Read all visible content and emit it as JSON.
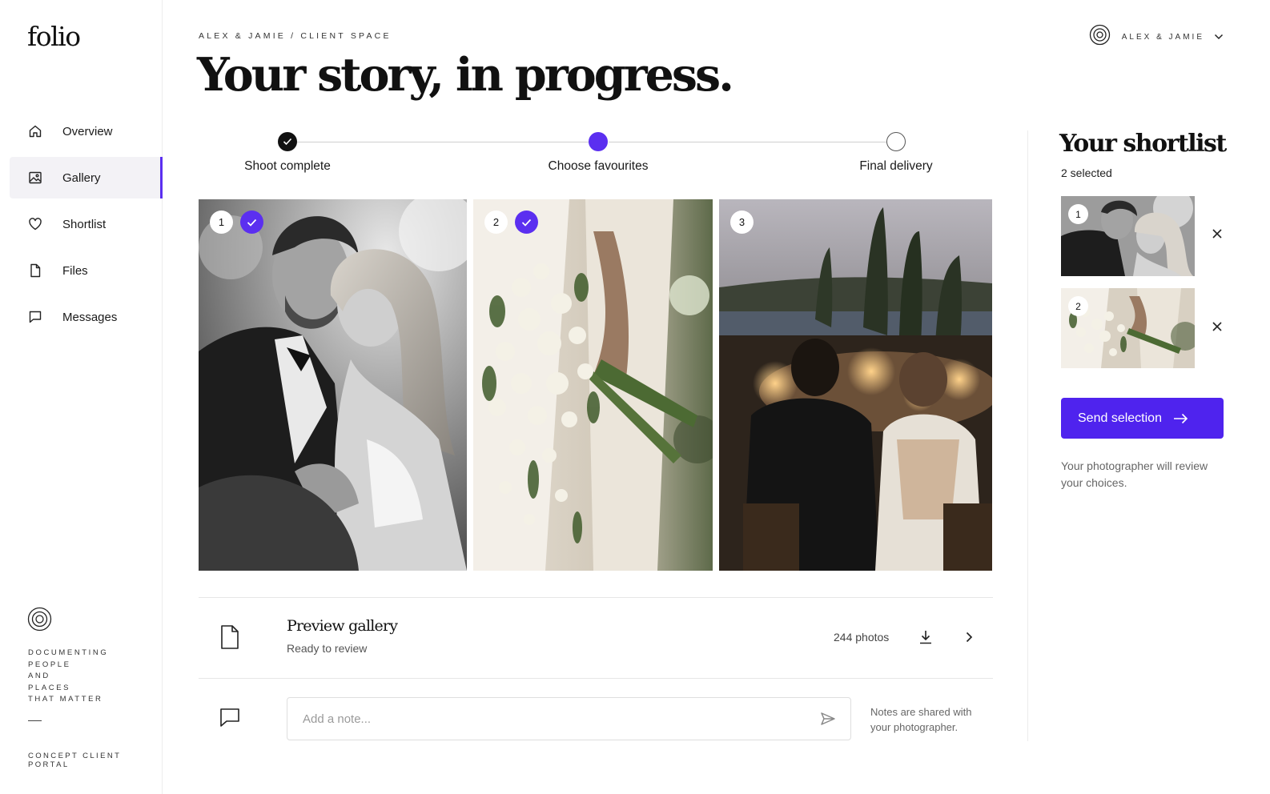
{
  "app": {
    "logo": "folio"
  },
  "sidebar": {
    "items": [
      {
        "label": "Overview",
        "icon": "home-icon",
        "active": false
      },
      {
        "label": "Gallery",
        "icon": "image-icon",
        "active": true
      },
      {
        "label": "Shortlist",
        "icon": "heart-icon",
        "active": false
      },
      {
        "label": "Files",
        "icon": "file-icon",
        "active": false
      },
      {
        "label": "Messages",
        "icon": "message-icon",
        "active": false
      }
    ],
    "tagline": "DOCUMENTING\nPEOPLE\nAND\nPLACES\nTHAT MATTER",
    "footer": "CONCEPT CLIENT PORTAL"
  },
  "header": {
    "breadcrumb": "ALEX & JAMIE / CLIENT SPACE",
    "title": "Your story, in progress.",
    "account_name": "ALEX & JAMIE"
  },
  "stepper": {
    "steps": [
      {
        "label": "Shoot complete",
        "state": "done"
      },
      {
        "label": "Choose favourites",
        "state": "current"
      },
      {
        "label": "Final delivery",
        "state": "upcoming"
      }
    ]
  },
  "gallery": {
    "photos": [
      {
        "number": "1",
        "selected": true,
        "subject": "couple-embrace-bw"
      },
      {
        "number": "2",
        "selected": true,
        "subject": "bridal-bouquet"
      },
      {
        "number": "3",
        "selected": false,
        "subject": "evening-dinner"
      }
    ]
  },
  "preview": {
    "title": "Preview gallery",
    "subtitle": "Ready to review",
    "count": "244 photos"
  },
  "note": {
    "placeholder": "Add a note...",
    "help": "Notes are shared with your photographer."
  },
  "shortlist": {
    "title": "Your shortlist",
    "count": "2 selected",
    "items": [
      {
        "number": "1"
      },
      {
        "number": "2"
      }
    ],
    "send_label": "Send selection",
    "help": "Your photographer will review your choices."
  },
  "colors": {
    "accent": "#5b2ff0",
    "button": "#4f23ee",
    "text": "#111111",
    "muted": "#666666"
  }
}
